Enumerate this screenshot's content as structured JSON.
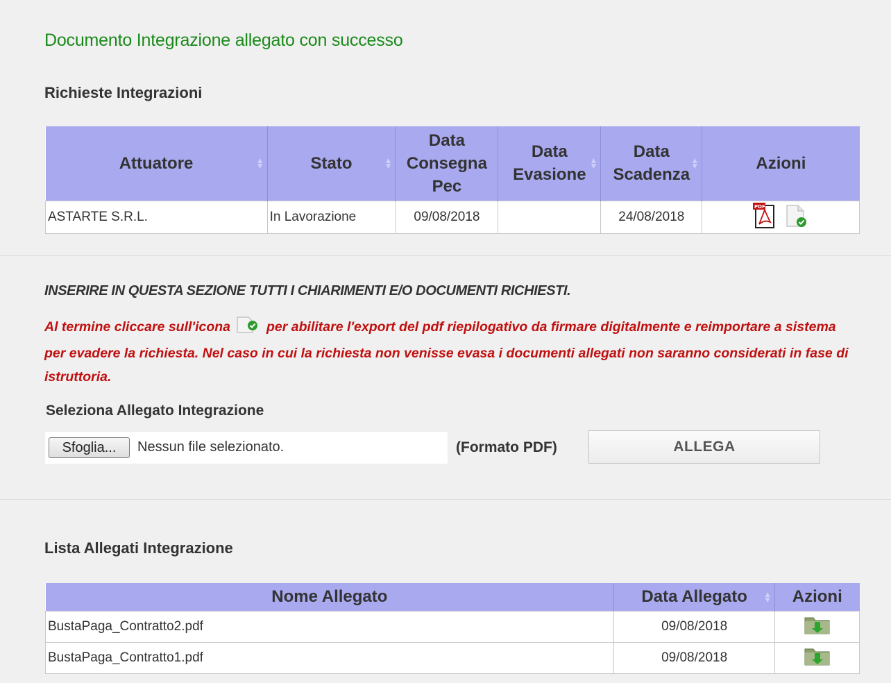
{
  "success_message": "Documento Integrazione allegato con successo",
  "richieste": {
    "title": "Richieste Integrazioni",
    "headers": {
      "attuatore": "Attuatore",
      "stato": "Stato",
      "data_consegna_1": "Data",
      "data_consegna_2": "Consegna",
      "data_consegna_3": "Pec",
      "data_evasione_1": "Data",
      "data_evasione_2": "Evasione",
      "data_scadenza_1": "Data",
      "data_scadenza_2": "Scadenza",
      "azioni": "Azioni"
    },
    "rows": [
      {
        "attuatore": "ASTARTE S.R.L.",
        "stato": "In Lavorazione",
        "data_consegna": "09/08/2018",
        "data_evasione": "",
        "data_scadenza": "24/08/2018"
      }
    ]
  },
  "instructions": {
    "heading": "INSERIRE IN QUESTA SEZIONE TUTTI I CHIARIMENTI E/O DOCUMENTI RICHIESTI.",
    "red_before_icon": "Al termine cliccare sull'icona",
    "red_after_icon": "per abilitare l'export del pdf riepilogativo da firmare digitalmente e reimportare a sistema per evadere la richiesta. Nel caso in cui la richiesta non venisse evasa i documenti allegati non saranno considerati in fase di istruttoria."
  },
  "upload": {
    "label": "Seleziona Allegato Integrazione",
    "browse_label": "Sfoglia...",
    "file_status": "Nessun file selezionato.",
    "format_hint": "(Formato PDF)",
    "submit_label": "ALLEGA"
  },
  "allegati": {
    "title": "Lista Allegati Integrazione",
    "headers": {
      "nome": "Nome Allegato",
      "data": "Data Allegato",
      "azioni": "Azioni"
    },
    "rows": [
      {
        "nome": "BustaPaga_Contratto2.pdf",
        "data": "09/08/2018"
      },
      {
        "nome": "BustaPaga_Contratto1.pdf",
        "data": "09/08/2018"
      }
    ]
  },
  "colors": {
    "success": "#1a8a1a",
    "table_header": "#a9a9f0",
    "warning_text": "#c01010"
  },
  "icons": [
    "pdf-icon",
    "document-check-icon",
    "download-folder-icon",
    "sort-icon"
  ]
}
